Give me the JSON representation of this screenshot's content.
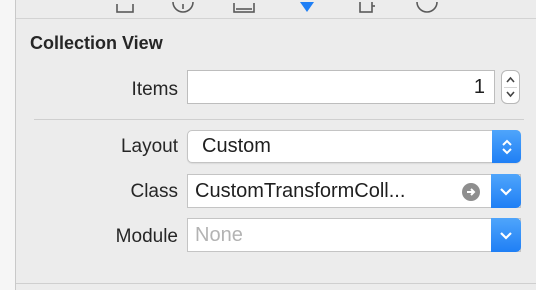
{
  "toolbar": {
    "tabs": [
      {
        "icon": "file-icon"
      },
      {
        "icon": "quick-help-icon"
      },
      {
        "icon": "identity-icon"
      },
      {
        "icon": "attributes-icon",
        "selected": true
      },
      {
        "icon": "size-icon"
      },
      {
        "icon": "connections-icon"
      }
    ],
    "selected_color": "#1f7ff5"
  },
  "section": {
    "title": "Collection View"
  },
  "fields": {
    "items": {
      "label": "Items",
      "value": "1"
    },
    "layout": {
      "label": "Layout",
      "value": "Custom"
    },
    "class": {
      "label": "Class",
      "value": "CustomTransformColl..."
    },
    "module": {
      "label": "Module",
      "placeholder": "None"
    }
  },
  "colors": {
    "accent": "#1f7ff5",
    "background": "#ececec"
  }
}
